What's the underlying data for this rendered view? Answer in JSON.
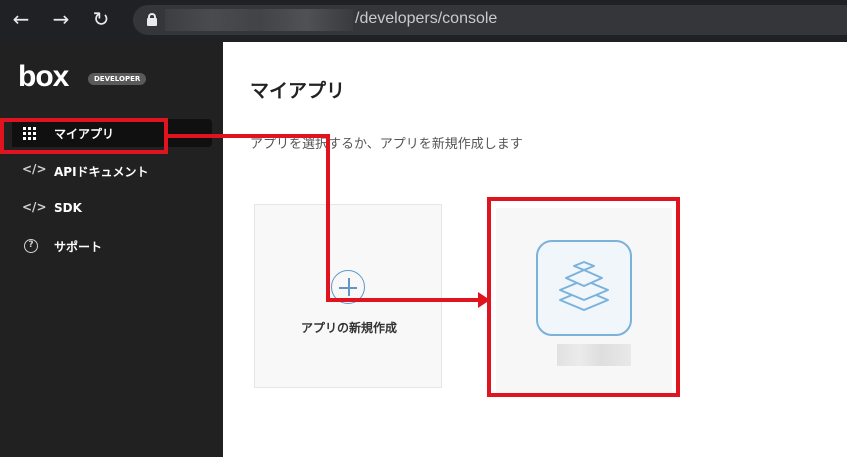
{
  "browser": {
    "url_suffix": "/developers/console"
  },
  "sidebar": {
    "logo": "box",
    "badge": "DEVELOPER",
    "items": [
      {
        "label": "マイアプリ",
        "icon": "grid-icon",
        "active": true
      },
      {
        "label": "APIドキュメント",
        "icon": "code-icon",
        "icon_glyph": "</>"
      },
      {
        "label": "SDK",
        "icon": "code-icon",
        "icon_glyph": "</>"
      },
      {
        "label": "サポート",
        "icon": "help-icon",
        "icon_glyph": "?"
      }
    ]
  },
  "main": {
    "title": "マイアプリ",
    "subtitle": "アプリを選択するか、アプリを新規作成します",
    "new_app_label": "アプリの新規作成"
  },
  "colors": {
    "highlight": "#e0141e",
    "accent": "#7ab2dc",
    "sidebar": "#212121"
  }
}
